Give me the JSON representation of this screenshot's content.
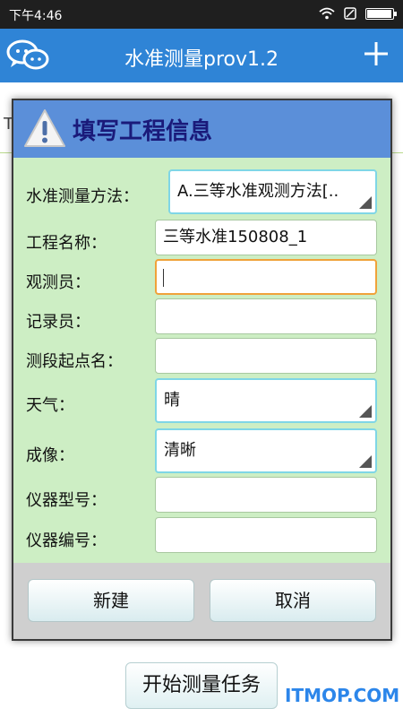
{
  "status": {
    "time": "下午4:46",
    "battery_level": 0.95
  },
  "app": {
    "title": "水准测量prov1.2",
    "add_icon": "plus-icon",
    "logo_icon": "chat-bubbles-icon"
  },
  "background": {
    "partial_char": "T"
  },
  "dialog": {
    "title": "填写工程信息",
    "icon": "warning-icon",
    "fields": [
      {
        "label": "水准测量方法：",
        "value": "A.三等水准观测方法[..",
        "type": "spinner"
      },
      {
        "label": "工程名称：",
        "value": "三等水准150808_1",
        "type": "text"
      },
      {
        "label": "观测员：",
        "value": "",
        "type": "text",
        "focused": true
      },
      {
        "label": "记录员：",
        "value": "",
        "type": "text"
      },
      {
        "label": "测段起点名：",
        "value": "",
        "type": "text"
      },
      {
        "label": "天气：",
        "value": "晴",
        "type": "spinner"
      },
      {
        "label": "成像：",
        "value": "清晰",
        "type": "spinner"
      },
      {
        "label": "仪器型号：",
        "value": "",
        "type": "text"
      },
      {
        "label": "仪器编号：",
        "value": "",
        "type": "text"
      }
    ],
    "buttons": {
      "new": "新建",
      "cancel": "取消"
    }
  },
  "main": {
    "start_button": "开始测量任务"
  },
  "watermark": "ITMOP.COM",
  "colors": {
    "appbar": "#2f84d6",
    "dialog_header": "#5b8fd9",
    "dialog_body": "#cdeec4",
    "focus": "#f0a23a"
  }
}
